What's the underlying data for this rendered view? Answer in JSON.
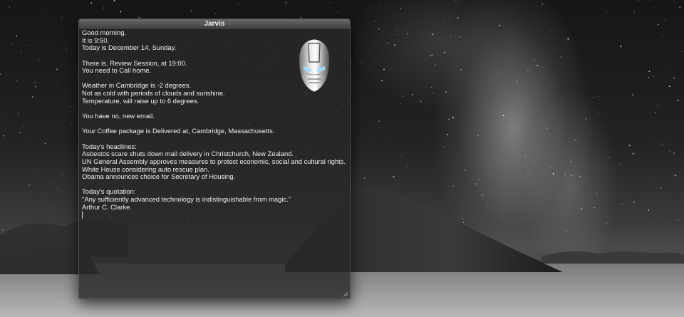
{
  "window": {
    "title": "Jarvis",
    "icons": {
      "avatar": "iron-man-helmet",
      "resize": "resize-grip-icon"
    },
    "lines": [
      "Good morning.",
      "It is 9:50.",
      "Today is December 14, Sunday.",
      "",
      "There is, Review Session, at 19:00.",
      "You need to Call home.",
      "",
      "Weather in Cambridge is -2 degrees.",
      "Not as cold with periods of clouds and sunshine.",
      "Temperature, will raise up to  6  degrees.",
      "",
      "You have no, new email.",
      "",
      "Your Coffee  package is Delivered at, Cambridge, Massachusetts.",
      "",
      "Today's headlines:",
      "Asbestos scare shuts down mail delivery in Christchurch, New Zealand.",
      "UN General Assembly approves measures to protect economic, social and cultural rights.",
      "White House considering auto rescue plan.",
      "Obama announces choice for Secretary of Housing.",
      "",
      "Today's quotation:",
      "\"Any sufficiently advanced technology is indistinguishable from magic.\"",
      "Arthur C. Clarke."
    ]
  }
}
